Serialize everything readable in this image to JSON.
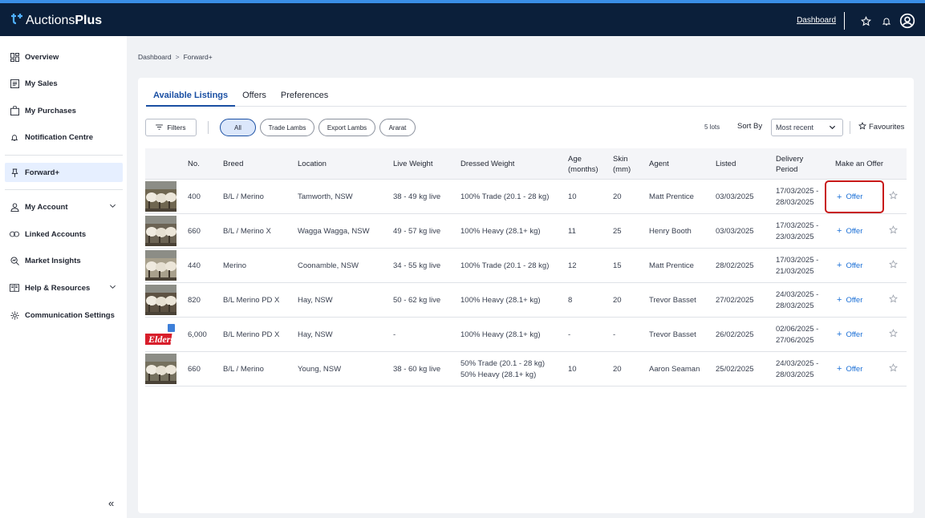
{
  "app": {
    "logo_prefix": "Auctions",
    "logo_suffix": "Plus"
  },
  "topbar": {
    "dashboard_link": "Dashboard",
    "icons": [
      "star-icon",
      "bell-icon",
      "user-circle-icon"
    ]
  },
  "sidebar": {
    "items": [
      {
        "label": "Overview",
        "icon": "grid-icon"
      },
      {
        "label": "My Sales",
        "icon": "receipt-icon"
      },
      {
        "label": "My Purchases",
        "icon": "bag-icon"
      },
      {
        "label": "Notification Centre",
        "icon": "bell-icon"
      },
      {
        "label": "Forward+",
        "icon": "pin-icon",
        "active": true
      },
      {
        "label": "My Account",
        "icon": "user-icon"
      },
      {
        "label": "Linked Accounts",
        "icon": "link-icon"
      },
      {
        "label": "Market Insights",
        "icon": "search-chart-icon"
      },
      {
        "label": "Help & Resources",
        "icon": "book-icon"
      },
      {
        "label": "Communication Settings",
        "icon": "gear-icon"
      }
    ],
    "collapse": "«"
  },
  "breadcrumb": {
    "root": "Dashboard",
    "sep": ">",
    "current": "Forward+"
  },
  "tabs": [
    "Available Listings",
    "Offers",
    "Preferences"
  ],
  "toolbar": {
    "filters": "Filters",
    "chips": [
      "All",
      "Trade Lambs",
      "Export Lambs",
      "Ararat"
    ],
    "lots": "5 lots",
    "sort_by": "Sort By",
    "sort_value": "Most recent",
    "favourites": "Favourites"
  },
  "table": {
    "headers": {
      "no": "No.",
      "breed": "Breed",
      "location": "Location",
      "live_weight": "Live Weight",
      "dressed_weight": "Dressed Weight",
      "age_1": "Age",
      "age_2": "(months)",
      "skin_1": "Skin",
      "skin_2": "(mm)",
      "agent": "Agent",
      "listed": "Listed",
      "delivery_1": "Delivery",
      "delivery_2": "Period",
      "offer": "Make an Offer"
    },
    "offer_label": "Offer",
    "offer_plus": "+",
    "rows": [
      {
        "no": "400",
        "breed": "B/L / Merino",
        "location": "Tamworth, NSW",
        "live": "38 - 49 kg live",
        "dressed1": "100% Trade (20.1 - 28 kg)",
        "dressed2": "",
        "age": "10",
        "skin": "20",
        "agent": "Matt Prentice",
        "listed": "03/03/2025",
        "del1": "17/03/2025 -",
        "del2": "28/03/2025",
        "thumb": "sheep"
      },
      {
        "no": "660",
        "breed": "B/L / Merino X",
        "location": "Wagga Wagga, NSW",
        "live": "49 - 57 kg live",
        "dressed1": "100% Heavy (28.1+ kg)",
        "dressed2": "",
        "age": "11",
        "skin": "25",
        "agent": "Henry Booth",
        "listed": "03/03/2025",
        "del1": "17/03/2025 -",
        "del2": "23/03/2025",
        "thumb": "sheep"
      },
      {
        "no": "440",
        "breed": "Merino",
        "location": "Coonamble, NSW",
        "live": "34 - 55 kg live",
        "dressed1": "100% Trade (20.1 - 28 kg)",
        "dressed2": "",
        "age": "12",
        "skin": "15",
        "agent": "Matt Prentice",
        "listed": "28/02/2025",
        "del1": "17/03/2025 -",
        "del2": "21/03/2025",
        "thumb": "sheep"
      },
      {
        "no": "820",
        "breed": "B/L Merino PD X",
        "location": "Hay, NSW",
        "live": "50 - 62 kg live",
        "dressed1": "100% Heavy (28.1+ kg)",
        "dressed2": "",
        "age": "8",
        "skin": "20",
        "agent": "Trevor Basset",
        "listed": "27/02/2025",
        "del1": "24/03/2025 -",
        "del2": "28/03/2025",
        "thumb": "sheep"
      },
      {
        "no": "6,000",
        "breed": "B/L Merino PD X",
        "location": "Hay, NSW",
        "live": "-",
        "dressed1": "100% Heavy (28.1+ kg)",
        "dressed2": "",
        "age": "-",
        "skin": "-",
        "agent": "Trevor Basset",
        "listed": "26/02/2025",
        "del1": "02/06/2025 -",
        "del2": "27/06/2025",
        "thumb": "elders"
      },
      {
        "no": "660",
        "breed": "B/L / Merino",
        "location": "Young, NSW",
        "live": "38 - 60 kg live",
        "dressed1": "50% Trade (20.1 - 28 kg)",
        "dressed2": "50% Heavy (28.1+ kg)",
        "age": "10",
        "skin": "20",
        "agent": "Aaron Seaman",
        "listed": "25/02/2025",
        "del1": "24/03/2025 -",
        "del2": "28/03/2025",
        "thumb": "sheep"
      }
    ],
    "elders_logo_text": "Elders"
  }
}
